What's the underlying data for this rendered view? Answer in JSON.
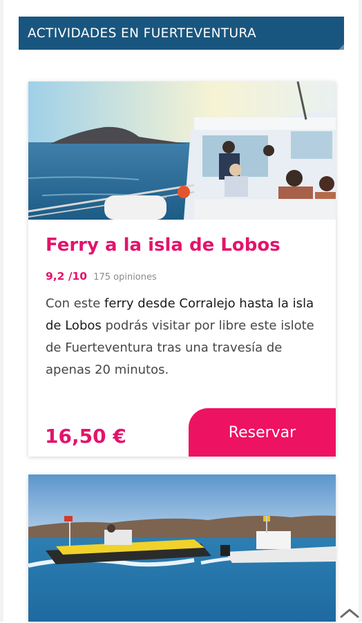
{
  "section": {
    "title": "ACTIVIDADES EN FUERTEVENTURA"
  },
  "cards": [
    {
      "title": "Ferry a la isla de Lobos",
      "rating": "9,2 /10",
      "reviews": "175 opiniones",
      "description": {
        "part1": "Con este ",
        "link": "ferry desde Corralejo hasta la isla de Lobos",
        "part2": " podrás visitar por libre este islote de Fuerteventura tras una travesía de apenas 20 minutos."
      },
      "price": "16,50 €",
      "button_label": "Reservar"
    }
  ],
  "icons": {
    "scroll_top": "chevron-up-icon"
  },
  "colors": {
    "header_bg": "#19567f",
    "accent": "#e3136b",
    "button_bg": "#ee1262"
  }
}
